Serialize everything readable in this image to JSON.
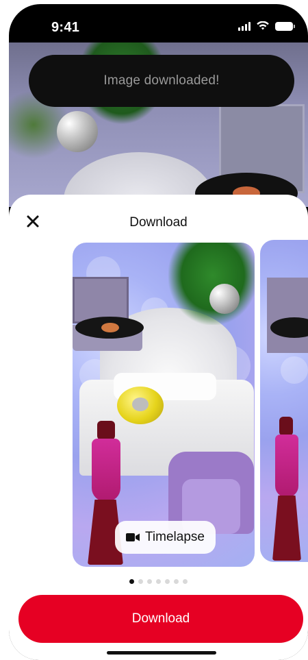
{
  "status_bar": {
    "time": "9:41",
    "icons": [
      "signal-icon",
      "wifi-icon",
      "battery-icon"
    ]
  },
  "toast": {
    "message": "Image downloaded!"
  },
  "sheet": {
    "title": "Download",
    "close_icon": "close-icon"
  },
  "carousel": {
    "active_index": 0,
    "total_pages": 7,
    "main_card": {
      "badge_icon": "video-camera-icon",
      "badge_label": "Timelapse"
    }
  },
  "actions": {
    "download_label": "Download",
    "accent_color": "#e60023"
  }
}
